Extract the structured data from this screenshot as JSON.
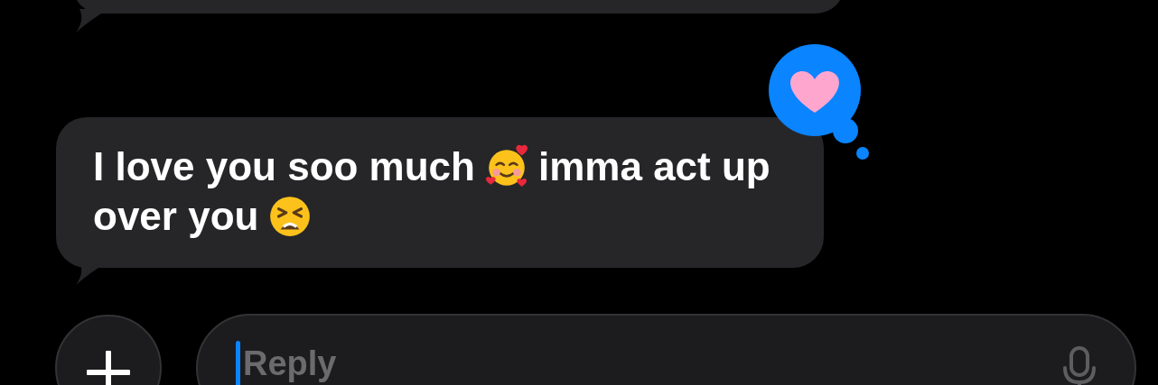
{
  "message": {
    "lines": [
      [
        {
          "kind": "text",
          "text": "I love you soo much"
        },
        {
          "kind": "emoji_hearts"
        },
        {
          "kind": "text",
          "text": "imma act up"
        }
      ],
      [
        {
          "kind": "text",
          "text": "over you"
        },
        {
          "kind": "emoji_tired"
        }
      ]
    ],
    "reaction": {
      "kind": "heart"
    }
  },
  "composer": {
    "placeholder": "Reply",
    "focused": true
  }
}
